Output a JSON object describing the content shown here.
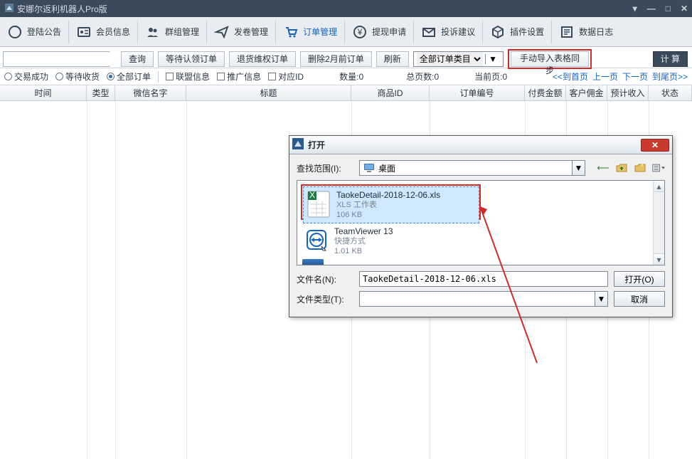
{
  "title": "安娜尔返利机器人Pro版",
  "nav": [
    "登陆公告",
    "会员信息",
    "群组管理",
    "发卷管理",
    "订单管理",
    "提现申请",
    "投诉建议",
    "插件设置",
    "数据日志"
  ],
  "toolbar": {
    "query": "查询",
    "wait_claim": "等待认领订单",
    "refund": "退货维权订单",
    "delete_old": "删除2月前订单",
    "refresh": "刷新",
    "category": "全部订单类目",
    "manual_import": "手动导入表格同步",
    "calc": "计 算"
  },
  "filters": {
    "r1": "交易成功",
    "r2": "等待收货",
    "r3": "全部订单",
    "c1": "联盟信息",
    "c2": "推广信息",
    "c3": "对应ID",
    "count_l": "数量:",
    "count_v": "0",
    "pages_l": "总页数:",
    "pages_v": "0",
    "cur_l": "当前页:",
    "cur_v": "0",
    "first": "<<到首页",
    "prev": "上一页",
    "next": "下一页",
    "last": "到尾页>>"
  },
  "headers": [
    "时间",
    "类型",
    "微信名字",
    "标题",
    "商品ID",
    "订单编号",
    "付费金额",
    "客户佣金",
    "预计收入",
    "状态"
  ],
  "dialog": {
    "title": "打开",
    "look_in": "查找范围(I):",
    "look_in_val": "桌面",
    "files": [
      {
        "name": "TaokeDetail-2018-12-06.xls",
        "type": "XLS 工作表",
        "size": "106 KB",
        "icon": "xls"
      },
      {
        "name": "TeamViewer 13",
        "type": "快捷方式",
        "size": "1.01 KB",
        "icon": "tv"
      }
    ],
    "filename_l": "文件名(N):",
    "filename_v": "TaokeDetail-2018-12-06.xls",
    "filetype_l": "文件类型(T):",
    "open": "打开(O)",
    "cancel": "取消"
  }
}
